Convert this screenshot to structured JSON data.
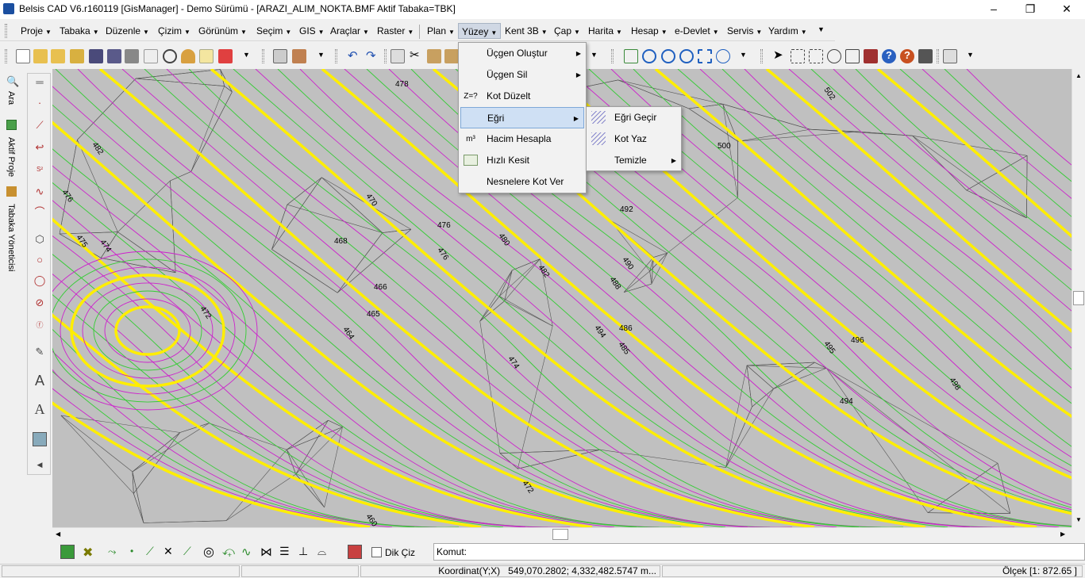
{
  "window": {
    "title": "Belsis CAD V6.r160119 [GisManager] - Demo Sürümü - [ARAZI_ALIM_NOKTA.BMF  Aktif Tabaka=TBK]",
    "controls": [
      "–",
      "❐",
      "✕"
    ]
  },
  "menubar": {
    "items": [
      "Proje",
      "Tabaka",
      "Düzenle",
      "Çizim",
      "Görünüm",
      "Seçim",
      "GIS",
      "Araçlar",
      "Raster",
      "Plan",
      "Yüzey",
      "Kent 3B",
      "Çap",
      "Harita",
      "Hesap",
      "e-Devlet",
      "Servis",
      "Yardım"
    ]
  },
  "left_dock": {
    "items": [
      "Ara",
      "Aktif Proje",
      "Tabaka Yöneticisi"
    ]
  },
  "map": {
    "background": "#c0c0c0",
    "contour_minor_colors": [
      "#33cc33",
      "#cc22cc"
    ],
    "contour_major_color": "#ffee00",
    "tin_color": "#555555",
    "contour_labels": [
      "478",
      "502",
      "482",
      "500",
      "476",
      "470",
      "476",
      "476",
      "480",
      "492",
      "475",
      "474",
      "468",
      "482",
      "490",
      "466",
      "488",
      "472",
      "465",
      "464",
      "494",
      "486",
      "485",
      "495",
      "496",
      "474",
      "498",
      "494",
      "472",
      "460"
    ]
  },
  "yuzey_menu": {
    "items": [
      {
        "label": "Üçgen Oluştur",
        "icon": "",
        "submenu": true
      },
      {
        "label": "Üçgen Sil",
        "icon": "",
        "submenu": true
      },
      {
        "label": "Kot Düzelt",
        "icon": "Z=?",
        "submenu": false
      },
      {
        "label": "Eğri",
        "icon": "",
        "submenu": true
      },
      {
        "label": "Hacim Hesapla",
        "icon": "m³",
        "submenu": false
      },
      {
        "label": "Hızlı Kesit",
        "icon": "",
        "submenu": false
      },
      {
        "label": "Nesnelere Kot Ver",
        "icon": "",
        "submenu": false
      }
    ]
  },
  "egri_submenu": {
    "items": [
      {
        "label": "Eğri Geçir",
        "submenu": false
      },
      {
        "label": "Kot Yaz",
        "submenu": false
      },
      {
        "label": "Temizle",
        "submenu": true
      }
    ]
  },
  "bottom": {
    "dik_ciz_label": "Dik Çiz",
    "komut_label": "Komut:"
  },
  "status": {
    "coordinate_label": "Koordinat(Y;X)",
    "coordinate_value": "549,070.2802; 4,332,482.5747 m...",
    "scale_label": "Ölçek [1: 872.65 ]"
  }
}
